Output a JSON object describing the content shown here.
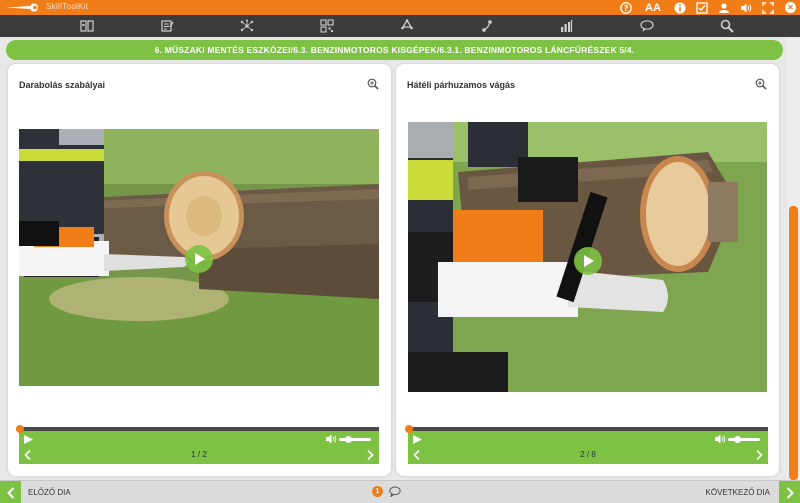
{
  "app": {
    "title": "SkillToolKit"
  },
  "top_icons": [
    "help-icon",
    "font-size-icon",
    "info-icon",
    "checklist-icon",
    "user-icon",
    "volume-icon",
    "fullscreen-icon",
    "close-icon"
  ],
  "font_size_label": "AA",
  "nav_icons": [
    "book-icon",
    "notes-icon",
    "network-icon",
    "qr-code-icon",
    "recycle-icon",
    "share-icon",
    "stats-icon",
    "chat-icon",
    "search-icon"
  ],
  "breadcrumb": "6. MŰSZAKI MENTÉS ESZKÖZEI/6.3. BENZINMOTOROS KISGÉPEK/6.3.1. BENZINMOTOROS LÁNCFŰRÉSZEK 5/4.",
  "panels": [
    {
      "title": "Darabolás szabályai",
      "page": "1 / 2",
      "progress": 0,
      "volume": 0.2
    },
    {
      "title": "Hátéli párhuzamos vágás",
      "page": "2 / 8",
      "progress": 0,
      "volume": 0.2
    }
  ],
  "bottom": {
    "prev_label": "ELŐZŐ DIA",
    "next_label": "KÖVETKEZŐ DIA",
    "note_count": "1"
  },
  "colors": {
    "accent": "#f07d17",
    "green": "#7dc242",
    "dark": "#3c3c3c"
  }
}
